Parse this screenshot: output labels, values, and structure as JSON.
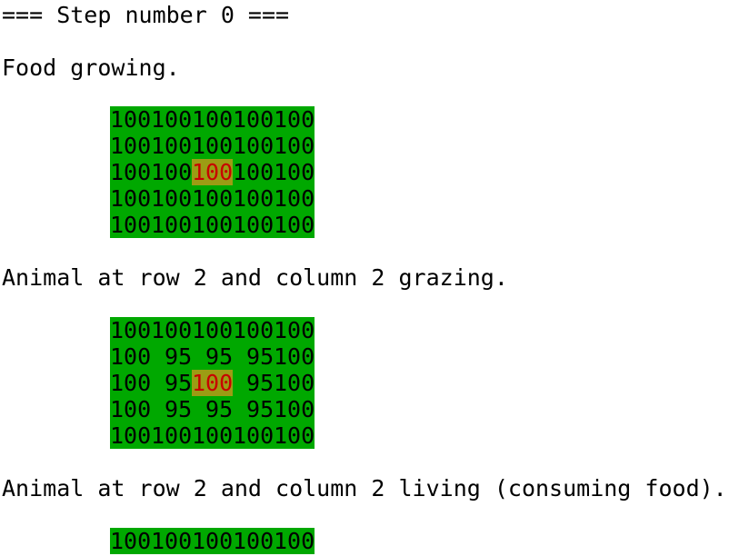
{
  "colors": {
    "background": "#ffffff",
    "grid_bg": "#00a800",
    "highlight_bg": "#9c9c14",
    "highlight_text": "#c80000",
    "text": "#000000"
  },
  "header": {
    "step_line": "=== Step number 0 ==="
  },
  "sections": [
    {
      "message": "Food growing.",
      "grid": [
        [
          "100",
          "100",
          "100",
          "100",
          "100"
        ],
        [
          "100",
          "100",
          "100",
          "100",
          "100"
        ],
        [
          "100",
          "100",
          "100",
          "100",
          "100"
        ],
        [
          "100",
          "100",
          "100",
          "100",
          "100"
        ],
        [
          "100",
          "100",
          "100",
          "100",
          "100"
        ]
      ],
      "highlight": {
        "row": 2,
        "col": 2
      }
    },
    {
      "message": "Animal at row 2 and column 2 grazing.",
      "grid": [
        [
          "100",
          "100",
          "100",
          "100",
          "100"
        ],
        [
          "100",
          " 95",
          " 95",
          " 95",
          "100"
        ],
        [
          "100",
          " 95",
          "100",
          " 95",
          "100"
        ],
        [
          "100",
          " 95",
          " 95",
          " 95",
          "100"
        ],
        [
          "100",
          "100",
          "100",
          "100",
          "100"
        ]
      ],
      "highlight": {
        "row": 2,
        "col": 2
      }
    },
    {
      "message": "Animal at row 2 and column 2 living (consuming food).",
      "grid": [
        [
          "100",
          "100",
          "100",
          "100",
          "100"
        ]
      ],
      "highlight": null
    }
  ]
}
